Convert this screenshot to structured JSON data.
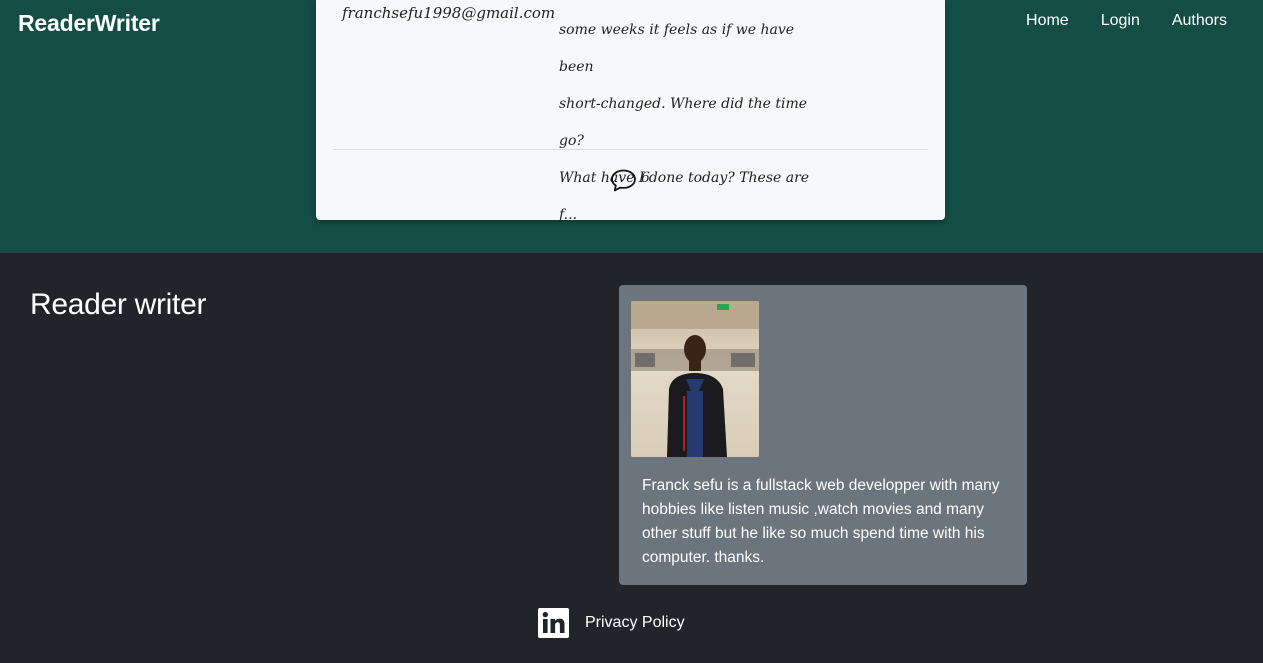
{
  "navbar": {
    "brand": "ReaderWriter",
    "links": [
      "Home",
      "Login",
      "Authors"
    ]
  },
  "post": {
    "author_email": "franchsefu1998@gmail.com",
    "excerpt_lines": [
      "some weeks it feels as if we have been",
      "short-changed. Where did the time go?",
      "What have I done today? These are f..."
    ],
    "comment_count": "6"
  },
  "footer": {
    "title": "Reader writer",
    "author": {
      "bio": "Franck sefu is a fullstack web developper with many hobbies like listen music ,watch movies and many other stuff but he like so much spend time with his computer. thanks."
    },
    "privacy_link": "Privacy Policy"
  },
  "icons": {
    "comment": "speech-bubble-icon",
    "linkedin": "linkedin-icon"
  },
  "colors": {
    "hero_bg": "#134d46",
    "footer_bg": "#212529",
    "author_card_bg": "#6c757d",
    "card_bg": "#f7f8fa"
  }
}
